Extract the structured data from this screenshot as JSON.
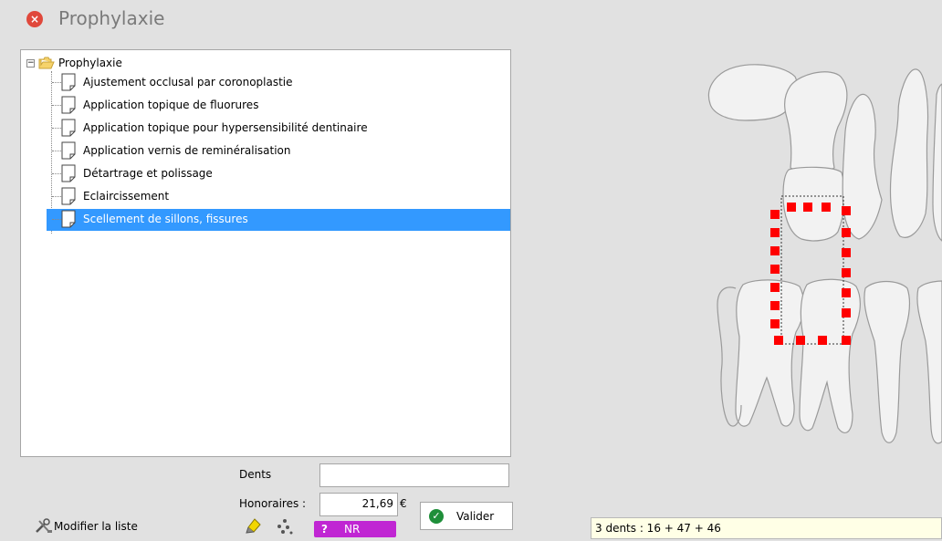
{
  "window": {
    "title": "Prophylaxie",
    "close_glyph": "×"
  },
  "tree": {
    "root_label": "Prophylaxie",
    "expander_glyph": "−",
    "items": [
      {
        "label": "Ajustement occlusal par coronoplastie",
        "selected": false
      },
      {
        "label": "Application topique de fluorures",
        "selected": false
      },
      {
        "label": "Application topique pour hypersensibilité dentinaire",
        "selected": false
      },
      {
        "label": "Application vernis de reminéralisation",
        "selected": false
      },
      {
        "label": "Détartrage et polissage",
        "selected": false
      },
      {
        "label": "Eclaircissement",
        "selected": false
      },
      {
        "label": "Scellement de sillons, fissures",
        "selected": true
      }
    ]
  },
  "form": {
    "dents_label": "Dents",
    "dents_value": "",
    "honoraires_label": "Honoraires :",
    "honoraires_value": "21,69",
    "currency": "€",
    "valider_label": "Valider",
    "check_glyph": "✓"
  },
  "footer": {
    "modifier_label": "Modifier la liste",
    "nr_badge_q": "?",
    "nr_badge_text": "NR",
    "status_text": "3 dents : 16 + 47 + 46"
  },
  "colors": {
    "selection": "#3399ff",
    "nr_badge": "#c026d3",
    "close": "#e0483b",
    "marker": "#ff0000"
  },
  "icons": {
    "close": "close-icon",
    "folder": "folder-open-icon",
    "document": "document-icon",
    "tools": "tools-icon",
    "highlighter": "highlighter-icon",
    "dots": "dots-icon",
    "check": "check-icon"
  }
}
